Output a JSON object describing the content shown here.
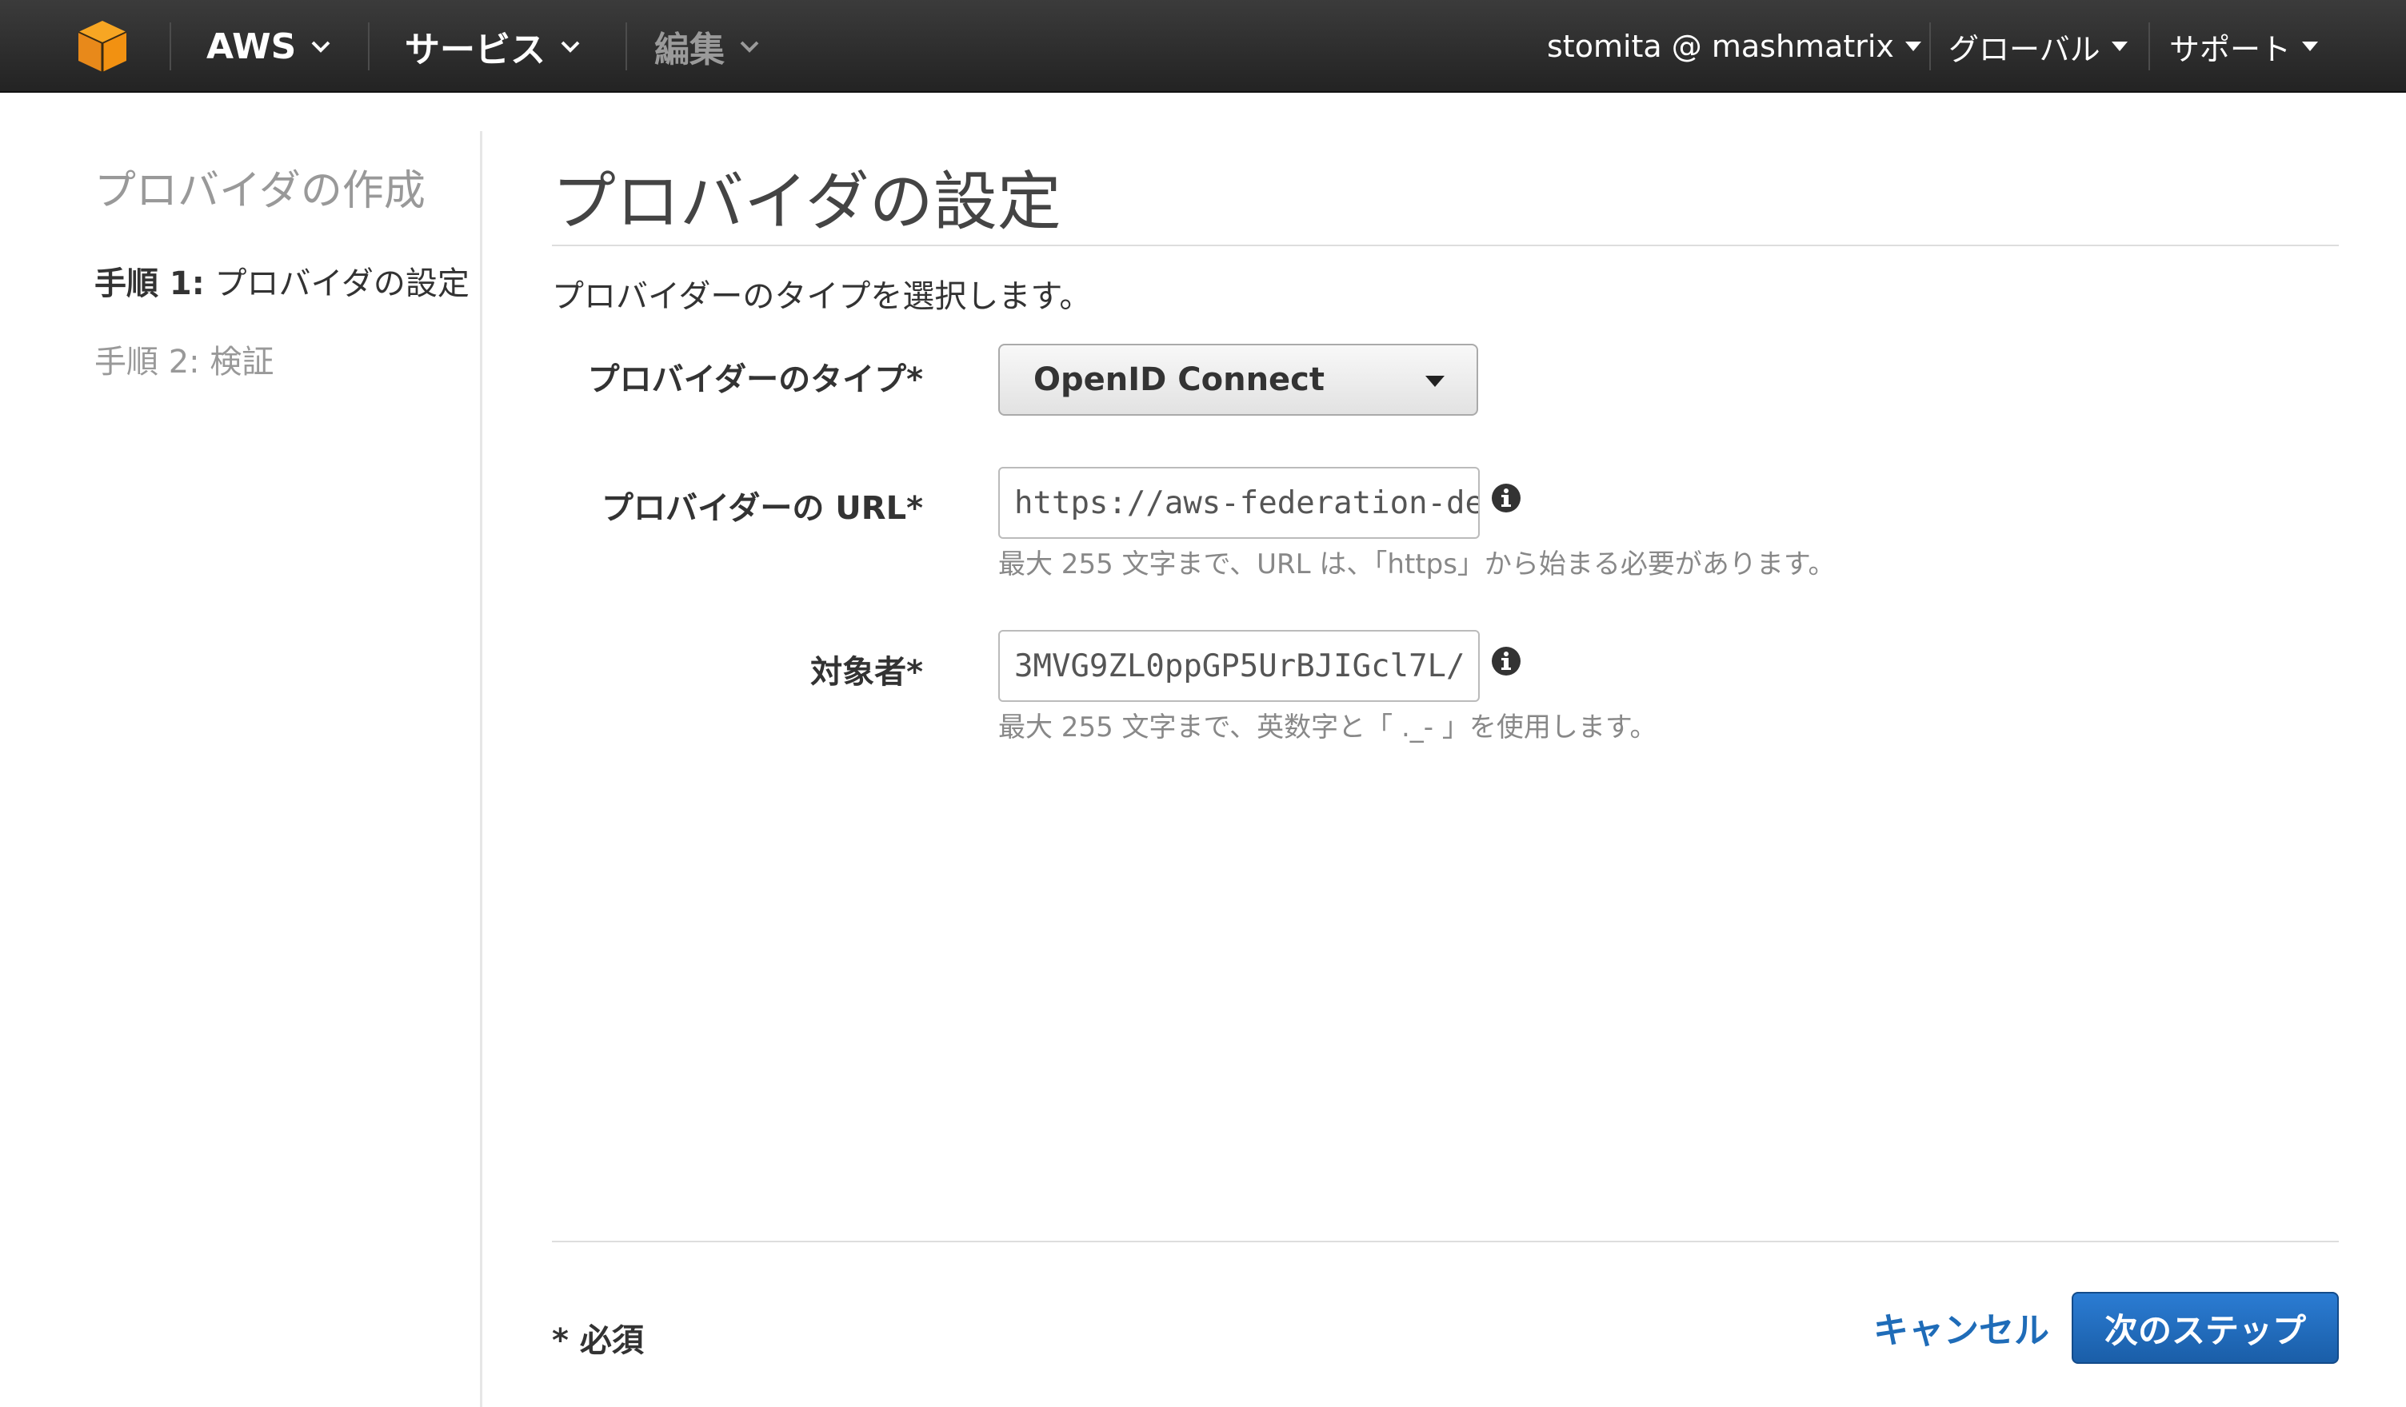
{
  "topbar": {
    "logo_icon": "aws-cube-icon",
    "aws_label": "AWS",
    "services_label": "サービス",
    "edit_label": "編集",
    "account_label": "stomita @ mashmatrix",
    "region_label": "グローバル",
    "support_label": "サポート"
  },
  "sidebar": {
    "title": "プロバイダの作成",
    "steps": [
      {
        "num": "手順 1:",
        "label": "プロバイダの設定",
        "state": "current"
      },
      {
        "num": "手順 2:",
        "label": "検証",
        "state": "pending"
      }
    ]
  },
  "main": {
    "title": "プロバイダの設定",
    "intro": "プロバイダーのタイプを選択します。",
    "provider_type": {
      "label": "プロバイダーのタイプ*",
      "value": "OpenID Connect"
    },
    "provider_url": {
      "label": "プロバイダーの URL*",
      "value": "https://aws-federation-dem",
      "hint": "最大 255 文字まで、URL は、「https」から始まる必要があります。",
      "info_icon": "info-icon"
    },
    "audience": {
      "label": "対象者*",
      "value": "3MVG9ZL0ppGP5UrBJIGcl7L/",
      "hint": "最大 255 文字まで、英数字と「 ._- 」を使用します。",
      "info_icon": "info-icon"
    }
  },
  "footer": {
    "required_note": "* 必須",
    "cancel_label": "キャンセル",
    "next_label": "次のステップ"
  },
  "colors": {
    "accent_blue": "#1f6cb8",
    "button_blue": "#1a5ea8",
    "topbar_bg": "#2b2b2b",
    "logo_orange": "#f29111"
  }
}
